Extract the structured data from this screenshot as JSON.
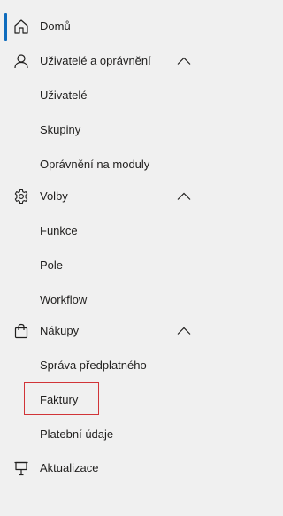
{
  "nav": {
    "home": {
      "label": "Domů",
      "icon": "home-icon"
    },
    "users_permissions": {
      "label": "Uživatelé a oprávnění",
      "icon": "person-icon",
      "expanded": true,
      "children": [
        {
          "label": "Uživatelé"
        },
        {
          "label": "Skupiny"
        },
        {
          "label": "Oprávnění na moduly"
        }
      ]
    },
    "options": {
      "label": "Volby",
      "icon": "gear-icon",
      "expanded": true,
      "children": [
        {
          "label": "Funkce"
        },
        {
          "label": "Pole"
        },
        {
          "label": "Workflow"
        }
      ]
    },
    "purchases": {
      "label": "Nákupy",
      "icon": "shopping-bag-icon",
      "expanded": true,
      "children": [
        {
          "label": "Správa předplatného"
        },
        {
          "label": "Faktury"
        },
        {
          "label": "Platební údaje"
        }
      ]
    },
    "updates": {
      "label": "Aktualizace",
      "icon": "presentation-icon"
    }
  },
  "colors": {
    "background": "#f0f0f0",
    "text": "#201f1e",
    "active_indicator": "#0f6cbd",
    "highlight_border": "#d13438"
  }
}
